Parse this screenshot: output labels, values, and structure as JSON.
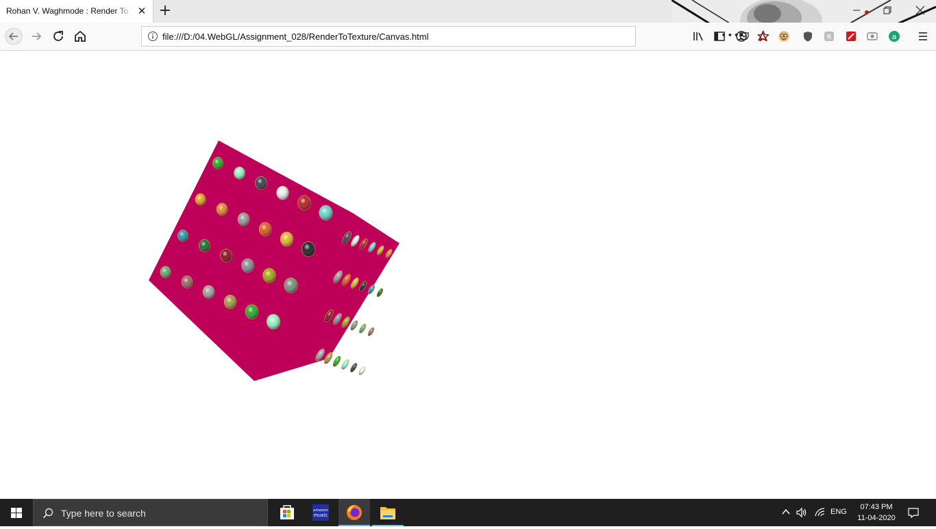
{
  "browser": {
    "tab": {
      "title": "Rohan V. Waghmode : Render To Texture"
    },
    "url": "file:///D:/04.WebGL/Assignment_028/RenderToTexture/Canvas.html",
    "page_actions_label": "•••"
  },
  "page": {
    "cube_color": "#bd0058",
    "sphere_colors": [
      "#1aa31a",
      "#8ef0c0",
      "#303040",
      "#f0e8f0",
      "#b01010",
      "#60d0c8",
      "#e0a010",
      "#e08020",
      "#909098",
      "#e05010",
      "#e0b020",
      "#101018",
      "#1890a0",
      "#106020",
      "#800010",
      "#808890",
      "#a0a000",
      "#708878",
      "#60a068",
      "#906060",
      "#9898a0",
      "#a09040"
    ]
  },
  "taskbar": {
    "search_placeholder": "Type here to search",
    "language": "ENG",
    "time": "07:43 PM",
    "date": "11-04-2020",
    "apps": [
      {
        "name": "Microsoft Store"
      },
      {
        "name": "Amazon Music",
        "label_top": "amazon",
        "label_bottom": "music"
      },
      {
        "name": "Firefox"
      },
      {
        "name": "File Explorer"
      }
    ]
  }
}
